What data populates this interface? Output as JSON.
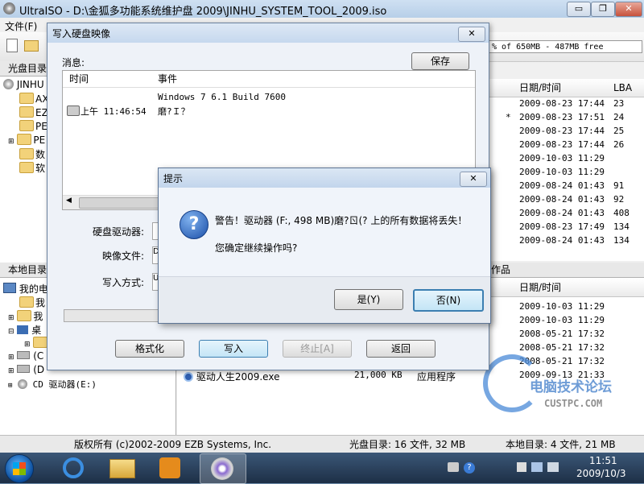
{
  "main_window": {
    "title": "UltraISO - D:\\金狐多功能系统维护盘 2009\\JINHU_SYSTEM_TOOL_2009.iso",
    "menu_file": "文件(F)",
    "size_info": "% of 650MB - 487MB free",
    "controls": {
      "minimize": "▭",
      "restore": "❐",
      "close": "✕"
    }
  },
  "iso_panel": {
    "header": "光盘目录",
    "root": "JINHU",
    "items": [
      "AX",
      "EZ",
      "PE",
      "PE",
      "数",
      "软"
    ]
  },
  "iso_files": {
    "col_datetime": "日期/时间",
    "col_lba": "LBA",
    "rows": [
      {
        "mark": "",
        "date": "2009-08-23 17:44",
        "lba": "23"
      },
      {
        "mark": "*",
        "date": "2009-08-23 17:51",
        "lba": "24"
      },
      {
        "mark": "",
        "date": "2009-08-23 17:44",
        "lba": "25"
      },
      {
        "mark": "",
        "date": "2009-08-23 17:44",
        "lba": "26"
      },
      {
        "mark": "",
        "date": "2009-10-03 11:29",
        "lba": ""
      },
      {
        "mark": "",
        "date": "2009-10-03 11:29",
        "lba": ""
      },
      {
        "mark": "",
        "date": "2009-08-24 01:43",
        "lba": "91"
      },
      {
        "mark": "",
        "date": "2009-08-24 01:43",
        "lba": "92"
      },
      {
        "mark": "",
        "date": "2009-08-24 01:43",
        "lba": "408"
      },
      {
        "mark": "",
        "date": "2009-08-23 17:49",
        "lba": "134"
      },
      {
        "mark": "",
        "date": "2009-08-24 01:43",
        "lba": "134"
      }
    ]
  },
  "local_panel": {
    "header": "本地目录",
    "items": [
      "我的电",
      "我",
      "我",
      "桌",
      "",
      "(C",
      "(D",
      "CD 驱动器(E:)"
    ]
  },
  "local_files": {
    "header_right": "作品",
    "col_datetime": "日期/时间",
    "rows": [
      "2009-10-03 11:29",
      "2009-10-03 11:29",
      "2008-05-21 17:32",
      "2008-05-21 17:32",
      "2008-05-21 17:32",
      "2009-09-13 21:33"
    ],
    "file_row": {
      "name": "驱动人生2009.exe",
      "size": "21,000 KB",
      "type": "应用程序"
    }
  },
  "status": {
    "copyright": "版权所有 (c)2002-2009 EZB Systems, Inc.",
    "iso_summary": "光盘目录: 16 文件, 32 MB",
    "local_summary": "本地目录: 4 文件, 21 MB"
  },
  "write_dialog": {
    "title": "写入硬盘映像",
    "messages_label": "消息:",
    "save_label": "保存",
    "col_time": "时间",
    "col_event": "事件",
    "log": [
      {
        "time": "",
        "event": "Windows 7 6.1 Build 7600"
      },
      {
        "time": "上午 11:46:54",
        "event": "磨?Ｉ？"
      }
    ],
    "drive_label": "硬盘驱动器:",
    "image_label": "映像文件:",
    "image_value": "D",
    "method_label": "写入方式:",
    "method_value": "U",
    "buttons": {
      "format": "格式化",
      "write": "写入",
      "stop": "终止[A]",
      "back": "返回"
    }
  },
  "prompt_dialog": {
    "title": "提示",
    "warning": "警告！驱动器 (F:, 498 MB)磨?ㄖ(? 上的所有数据将丢失！",
    "question": "您确定继续操作吗?",
    "yes": "是(Y)",
    "no": "否(N)"
  },
  "watermark": {
    "brand": "电脑技术论坛",
    "site": "CUSTPC.COM"
  },
  "taskbar": {
    "time": "11:51",
    "date": "2009/10/3"
  }
}
